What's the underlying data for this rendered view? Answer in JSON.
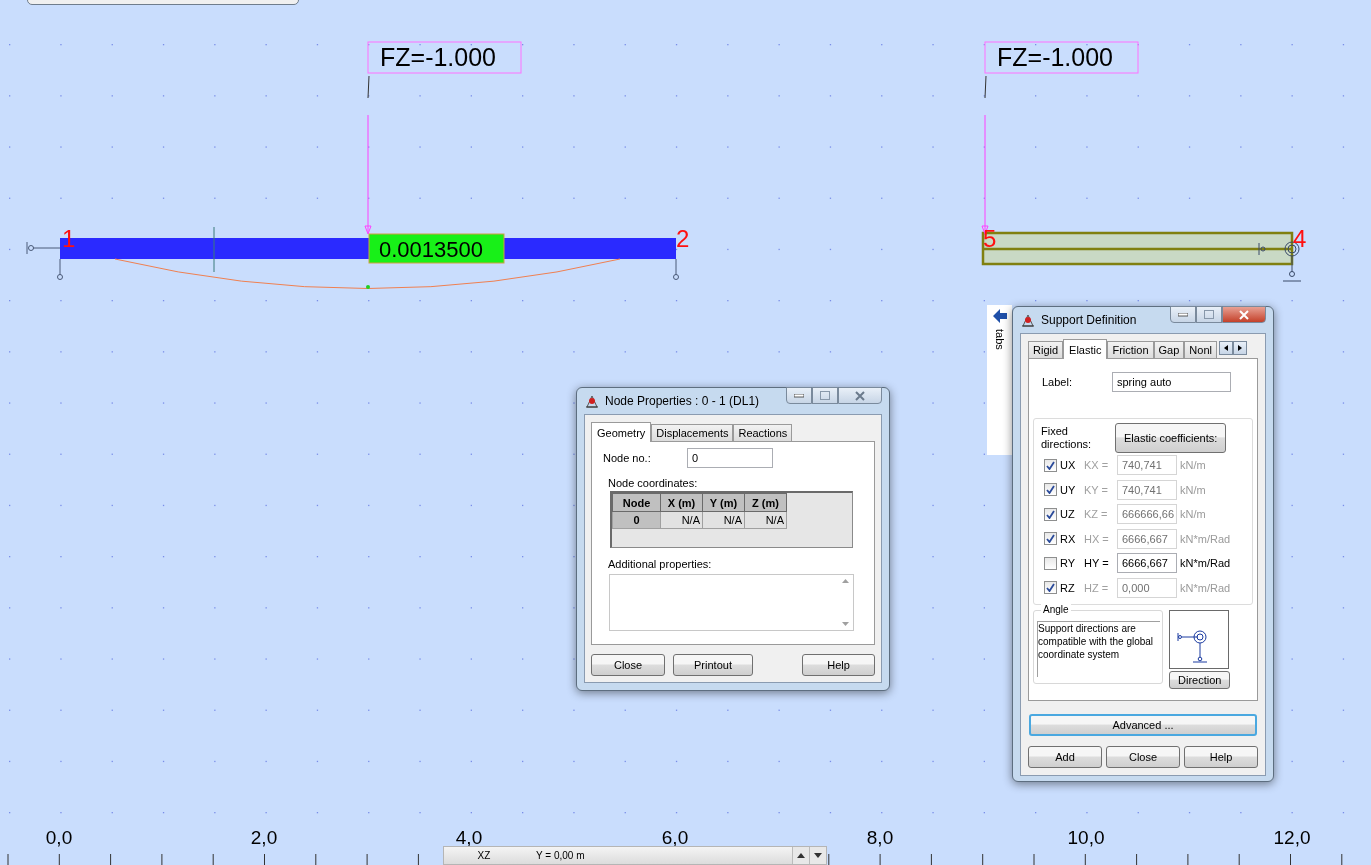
{
  "diagram": {
    "loads": [
      {
        "label": "FZ=-1.000"
      },
      {
        "label": "FZ=-1.000"
      }
    ],
    "node_labels": [
      "1",
      "2",
      "5",
      "4"
    ],
    "result_value": "0.0013500",
    "axis_labels": [
      "0,0",
      "2,0",
      "4,0",
      "6,0",
      "8,0",
      "10,0",
      "12,0"
    ]
  },
  "side_tab": {
    "label": "tabs"
  },
  "status_bar": {
    "plane": "XZ",
    "coordinate": "Y = 0,00 m"
  },
  "node_properties": {
    "title": "Node Properties : 0 - 1 (DL1)",
    "tabs": [
      {
        "label": "Geometry",
        "selected": true
      },
      {
        "label": "Displacements",
        "selected": false
      },
      {
        "label": "Reactions",
        "selected": false
      }
    ],
    "node_no_label": "Node no.:",
    "node_no": "0",
    "coordinates_label": "Node coordinates:",
    "table": {
      "columns": [
        "Node",
        "X (m)",
        "Y (m)",
        "Z (m)"
      ],
      "rows": [
        [
          "0",
          "N/A",
          "N/A",
          "N/A"
        ]
      ]
    },
    "additional_label": "Additional properties:",
    "buttons": [
      "Close",
      "Printout",
      "Help"
    ]
  },
  "support_definition": {
    "title": "Support Definition",
    "tabs": [
      {
        "label": "Rigid",
        "selected": false
      },
      {
        "label": "Elastic",
        "selected": true
      },
      {
        "label": "Friction",
        "selected": false
      },
      {
        "label": "Gap",
        "selected": false
      },
      {
        "label": "Nonl",
        "selected": false
      }
    ],
    "label_label": "Label:",
    "label_value": "spring auto",
    "fixed_label": "Fixed directions:",
    "elastic_button": "Elastic coefficients:",
    "directions": [
      {
        "name": "UX",
        "checked": true,
        "coef": "KX =",
        "value": "740,741",
        "unit": "kN/m"
      },
      {
        "name": "UY",
        "checked": true,
        "coef": "KY =",
        "value": "740,741",
        "unit": "kN/m"
      },
      {
        "name": "UZ",
        "checked": true,
        "coef": "KZ =",
        "value": "666666,66",
        "unit": "kN/m"
      },
      {
        "name": "RX",
        "checked": true,
        "coef": "HX =",
        "value": "6666,667",
        "unit": "kN*m/Rad"
      },
      {
        "name": "RY",
        "checked": false,
        "coef": "HY =",
        "value": "6666,667",
        "unit": "kN*m/Rad"
      },
      {
        "name": "RZ",
        "checked": true,
        "coef": "HZ =",
        "value": "0,000",
        "unit": "kN*m/Rad"
      }
    ],
    "angle_title": "Angle",
    "angle_text": "Support directions are compatible with the global coordinate system",
    "direction_button": "Direction",
    "advanced_button": "Advanced ...",
    "buttons": [
      "Add",
      "Close",
      "Help"
    ]
  }
}
